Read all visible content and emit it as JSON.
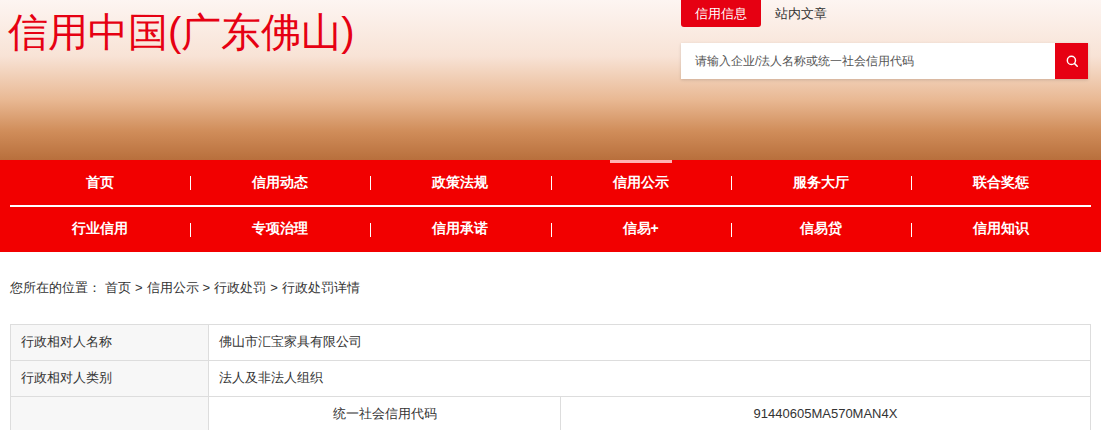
{
  "header": {
    "title": "信用中国(广东佛山)",
    "tabs": [
      {
        "label": "信用信息",
        "selected": true
      },
      {
        "label": "站内文章",
        "selected": false
      }
    ],
    "search": {
      "placeholder": "请输入企业/法人名称或统一社会信用代码"
    }
  },
  "nav": [
    [
      {
        "label": "首页",
        "selected": false
      },
      {
        "label": "信用动态",
        "selected": false
      },
      {
        "label": "政策法规",
        "selected": false
      },
      {
        "label": "信用公示",
        "selected": true
      },
      {
        "label": "服务大厅",
        "selected": false
      },
      {
        "label": "联合奖惩",
        "selected": false
      }
    ],
    [
      {
        "label": "行业信用",
        "selected": false
      },
      {
        "label": "专项治理",
        "selected": false
      },
      {
        "label": "信用承诺",
        "selected": false
      },
      {
        "label": "信易+",
        "selected": false
      },
      {
        "label": "信易贷",
        "selected": false
      },
      {
        "label": "信用知识",
        "selected": false
      }
    ]
  ],
  "breadcrumb": {
    "prefix": "您所在的位置：",
    "separator": ">",
    "items": [
      "首页",
      "信用公示",
      "行政处罚",
      "行政处罚详情"
    ]
  },
  "table": {
    "rows": [
      {
        "label": "行政相对人名称",
        "value": "佛山市汇宝家具有限公司"
      },
      {
        "label": "行政相对人类别",
        "value": "法人及非法人组织"
      }
    ],
    "sub_row": {
      "label": "",
      "key": "统一社会信用代码",
      "value": "91440605MA570MAN4X"
    }
  }
}
